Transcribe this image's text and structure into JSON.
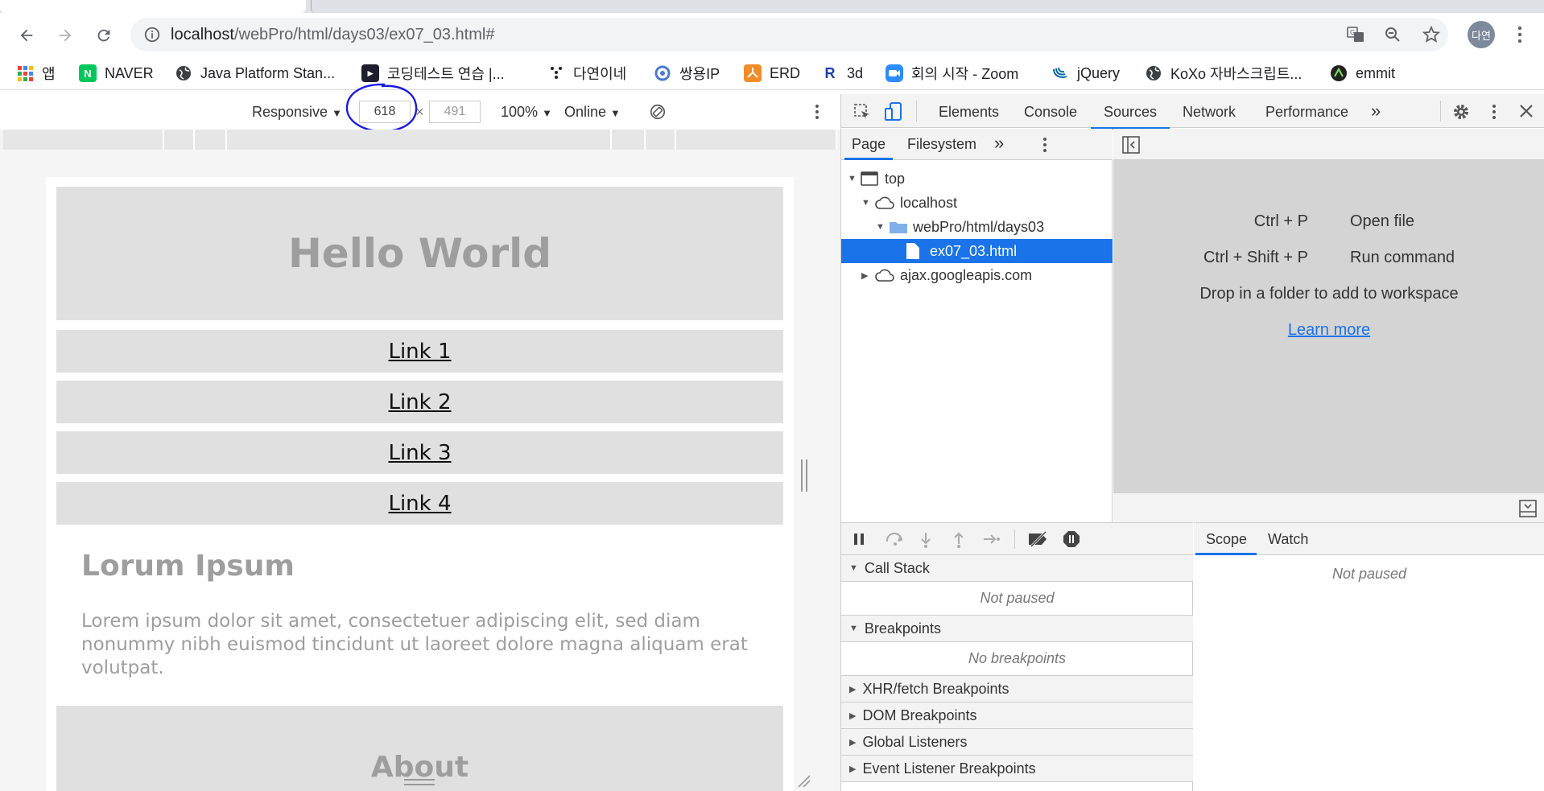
{
  "browser": {
    "url_host": "localhost",
    "url_path": "/webPro/html/days03/ex07_03.html#",
    "profile_initials": "다연"
  },
  "bookmarks": [
    {
      "label": "앱",
      "icon": "apps-grid-icon"
    },
    {
      "label": "NAVER",
      "icon": "naver-icon"
    },
    {
      "label": "Java Platform Stan...",
      "icon": "globe-icon"
    },
    {
      "label": "코딩테스트 연습 |...",
      "icon": "programmers-icon"
    },
    {
      "label": "다연이네",
      "icon": "dots-icon"
    },
    {
      "label": "쌍용IP",
      "icon": "swirl-icon"
    },
    {
      "label": "ERD",
      "icon": "erd-icon"
    },
    {
      "label": "3d",
      "icon": "r-icon"
    },
    {
      "label": "회의 시작 - Zoom",
      "icon": "zoom-icon"
    },
    {
      "label": "jQuery",
      "icon": "jquery-icon"
    },
    {
      "label": "KoXo 자바스크립트...",
      "icon": "globe-icon"
    },
    {
      "label": "emmit",
      "icon": "emmet-icon"
    }
  ],
  "device_toolbar": {
    "mode": "Responsive",
    "width": "618",
    "times": "×",
    "height": "491",
    "zoom": "100%",
    "network": "Online"
  },
  "page": {
    "hero_title": "Hello World",
    "links": [
      "Link 1",
      "Link 2",
      "Link 3",
      "Link 4"
    ],
    "section_title": "Lorum Ipsum",
    "section_text": "Lorem ipsum dolor sit amet, consectetuer adipiscing elit, sed diam nonummy nibh euismod tincidunt ut laoreet dolore magna aliquam erat volutpat.",
    "about_title": "About"
  },
  "devtools": {
    "tabs": [
      "Elements",
      "Console",
      "Sources",
      "Network",
      "Performance"
    ],
    "active_tab": "Sources",
    "more": "»",
    "navigator_tabs": [
      "Page",
      "Filesystem"
    ],
    "tree": [
      {
        "label": "top",
        "icon": "window-icon",
        "expanded": true
      },
      {
        "label": "localhost",
        "icon": "cloud-icon",
        "expanded": true
      },
      {
        "label": "webPro/html/days03",
        "icon": "folder-icon",
        "expanded": true
      },
      {
        "label": "ex07_03.html",
        "icon": "file-icon",
        "selected": true
      },
      {
        "label": "ajax.googleapis.com",
        "icon": "cloud-icon",
        "expanded": false
      }
    ],
    "shortcuts": [
      {
        "key": "Ctrl + P",
        "action": "Open file"
      },
      {
        "key": "Ctrl + Shift + P",
        "action": "Run command"
      }
    ],
    "workspace_hint": "Drop in a folder to add to workspace",
    "learn_more": "Learn more",
    "sections": [
      {
        "label": "Call Stack",
        "expanded": true,
        "content": "Not paused"
      },
      {
        "label": "Breakpoints",
        "expanded": true,
        "content": "No breakpoints"
      },
      {
        "label": "XHR/fetch Breakpoints",
        "expanded": false
      },
      {
        "label": "DOM Breakpoints",
        "expanded": false
      },
      {
        "label": "Global Listeners",
        "expanded": false
      },
      {
        "label": "Event Listener Breakpoints",
        "expanded": false
      }
    ],
    "scope_tabs": [
      "Scope",
      "Watch"
    ],
    "scope_content": "Not paused"
  },
  "colors": {
    "accent": "#1a73e8",
    "selection": "#1a73e8",
    "annotation": "#1a1adf"
  }
}
